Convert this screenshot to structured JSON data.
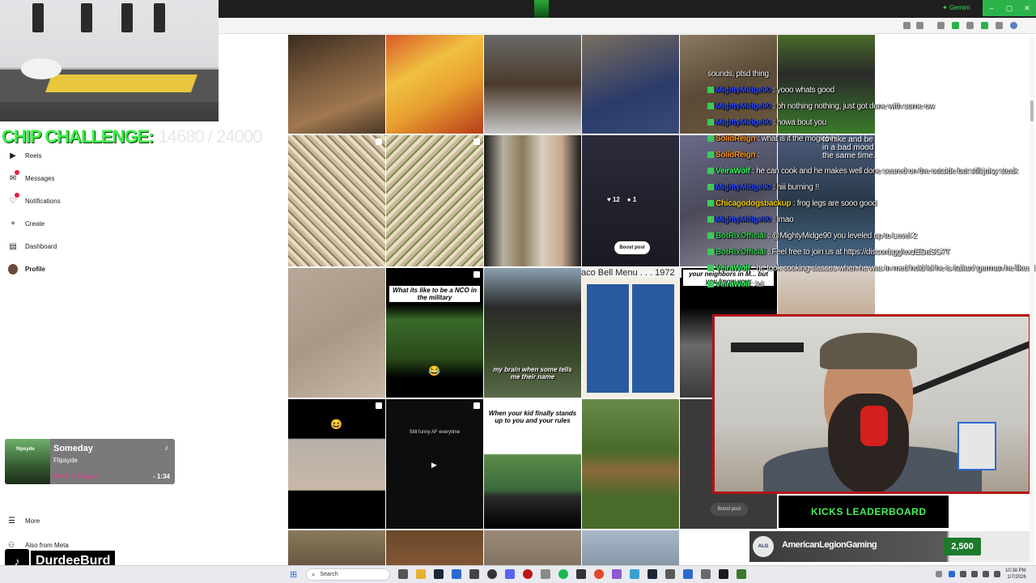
{
  "browser": {
    "gemini_label": "Gemini",
    "window_buttons": [
      "–",
      "▢",
      "✕"
    ]
  },
  "overlay": {
    "challenge_label": "CHIP CHALLENGE:",
    "challenge_count": "14680 / 24000"
  },
  "sidebar": {
    "items": [
      {
        "label": "Reels",
        "icon": "reels-icon",
        "glyph": "▶"
      },
      {
        "label": "Messages",
        "icon": "messages-icon",
        "glyph": "✉"
      },
      {
        "label": "Notifications",
        "icon": "heart-icon",
        "glyph": "♡"
      },
      {
        "label": "Create",
        "icon": "plus-icon",
        "glyph": "+"
      },
      {
        "label": "Dashboard",
        "icon": "dashboard-icon",
        "glyph": "▤"
      },
      {
        "label": "Profile",
        "icon": "avatar",
        "glyph": ""
      }
    ],
    "more_label": "More",
    "also_label": "Also from Meta"
  },
  "grid": {
    "post_stats": {
      "likes": "12",
      "comments": "1"
    },
    "boost_label": "Boost post",
    "nco_caption": "What its like to be a NCO in the military",
    "brain_caption": "my brain when some tells me their name",
    "kid_caption": "When your kid finally stands up to you and your rules",
    "still_funny_caption": "Still funny AF everytime",
    "taco_menu_title": "aco Bell Menu . . . 1972",
    "neighbors_caption": "your neighbors in M... but you know your"
  },
  "chat": [
    {
      "user": "",
      "message": "sounds, ptsd thing"
    },
    {
      "user": "MightyMidge90",
      "message": ": yooo whats good"
    },
    {
      "user": "MightyMidge90",
      "message": ": oh nothing nothing, just got done with some ow"
    },
    {
      "user": "MightyMidge90",
      "message": ": howa bout you"
    },
    {
      "user": "SolidReign",
      "message": ": what is it the moglobin"
    },
    {
      "user": "SolidReign",
      "message": ": "
    },
    {
      "user": "VeiraWolf",
      "message": ": he can cook and he makes well done seared on the outside but still juicy steak"
    },
    {
      "user": "MightyMidge90",
      "message": ": hiii burning !!"
    },
    {
      "user": "Chicagodogsbackup",
      "message": ": frog legs are sooo good"
    },
    {
      "user": "MightyMidge90",
      "message": ": lmao"
    },
    {
      "user": "BotRixOfficial",
      "message": ": @MightyMidge90 you leveled up to Level 2"
    },
    {
      "user": "BotRixOfficial",
      "message": ": Feel free to join us at https://discord.gg/exzEDuSG7T"
    },
    {
      "user": "VeiraWolf",
      "message": ": he took cooking classes when he was in med hold lol he is italian/ german he likes the"
    },
    {
      "user": "VeiraWolf",
      "message": ": lol"
    }
  ],
  "chat_colors": {
    "MightyMidge90": "#2f4cff",
    "SolidReign": "#ff9a1f",
    "VeiraWolf": "#3cff6a",
    "Chicagodogsbackup": "#f2d10a",
    "BotRixOfficial": "#3cc95a"
  },
  "chat_overlay_text": "to hike and be in a bad mood the same time.",
  "leaderboard": {
    "title": "KICKS LEADERBOARD",
    "name": "AmericanLegionGaming",
    "logo_text": "ALG",
    "score": "2,500",
    "accent": "#45f05a"
  },
  "player": {
    "song": "Someday",
    "artist": "Flipsyde",
    "album": "We The People",
    "time": "- 1:34",
    "album_art_text": "flipsyde"
  },
  "tiktok": {
    "handle": "DurdeeBurd"
  },
  "taskbar": {
    "search_placeholder": "Search",
    "time": "10:38 PM",
    "date": "1/7/2026"
  }
}
